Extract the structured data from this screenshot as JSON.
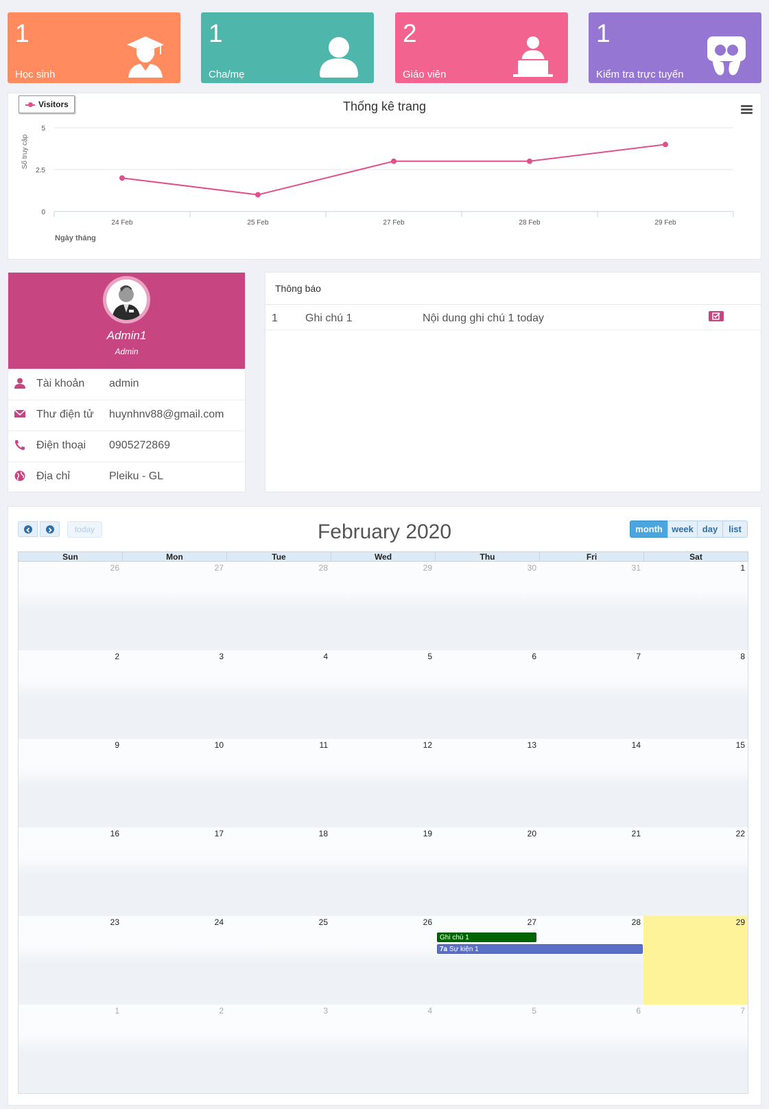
{
  "tiles": [
    {
      "count": "1",
      "label": "Học sinh",
      "icon": "graduate-icon",
      "color": "#ff8b5e"
    },
    {
      "count": "1",
      "label": "Cha/mẹ",
      "icon": "user-icon",
      "color": "#4fb6ab"
    },
    {
      "count": "2",
      "label": "Giáo viên",
      "icon": "teacher-icon",
      "color": "#f2648f"
    },
    {
      "count": "1",
      "label": "Kiểm tra trực tuyến",
      "icon": "online-test-icon",
      "color": "#9676d3"
    }
  ],
  "chart_data": {
    "type": "line",
    "title": "Thống kê trang",
    "xlabel": "Ngày tháng",
    "ylabel": "Số truy cập",
    "categories": [
      "24 Feb",
      "25 Feb",
      "27 Feb",
      "28 Feb",
      "29 Feb"
    ],
    "series": [
      {
        "name": "Visitors",
        "values": [
          2,
          1,
          3,
          3,
          4
        ],
        "color": "#e0508c"
      }
    ],
    "ylim": [
      0,
      5
    ],
    "yticks": [
      "0",
      "2.5",
      "5"
    ],
    "grid": true,
    "legend": "top-left"
  },
  "profile": {
    "name": "Admin1",
    "role": "Admin",
    "rows": [
      {
        "key": "Tài khoản",
        "value": "admin",
        "icon": "user-icon"
      },
      {
        "key": "Thư điện tử",
        "value": "huynhnv88@gmail.com",
        "icon": "envelope-icon"
      },
      {
        "key": "Điện thoại",
        "value": "0905272869",
        "icon": "phone-icon"
      },
      {
        "key": "Địa chỉ",
        "value": "Pleiku - GL",
        "icon": "globe-icon"
      }
    ]
  },
  "notices": {
    "heading": "Thông báo",
    "rows": [
      {
        "no": "1",
        "title": "Ghi chú 1",
        "content": "Nội dung ghi chú 1 today"
      }
    ]
  },
  "calendar": {
    "title": "February 2020",
    "today_label": "today",
    "views": [
      "month",
      "week",
      "day",
      "list"
    ],
    "active_view": "month",
    "weekdays": [
      "Sun",
      "Mon",
      "Tue",
      "Wed",
      "Thu",
      "Fri",
      "Sat"
    ],
    "weeks": [
      [
        "26",
        "27",
        "28",
        "29",
        "30",
        "31",
        "1"
      ],
      [
        "2",
        "3",
        "4",
        "5",
        "6",
        "7",
        "8"
      ],
      [
        "9",
        "10",
        "11",
        "12",
        "13",
        "14",
        "15"
      ],
      [
        "16",
        "17",
        "18",
        "19",
        "20",
        "21",
        "22"
      ],
      [
        "23",
        "24",
        "25",
        "26",
        "27",
        "28",
        "29"
      ],
      [
        "1",
        "2",
        "3",
        "4",
        "5",
        "6",
        "7"
      ]
    ],
    "events": [
      {
        "label": "Ghi chú 1",
        "time": "",
        "color": "#006400"
      },
      {
        "label": "Sự kiện 1",
        "time": "7a",
        "color": "#5a6fc6"
      }
    ]
  }
}
